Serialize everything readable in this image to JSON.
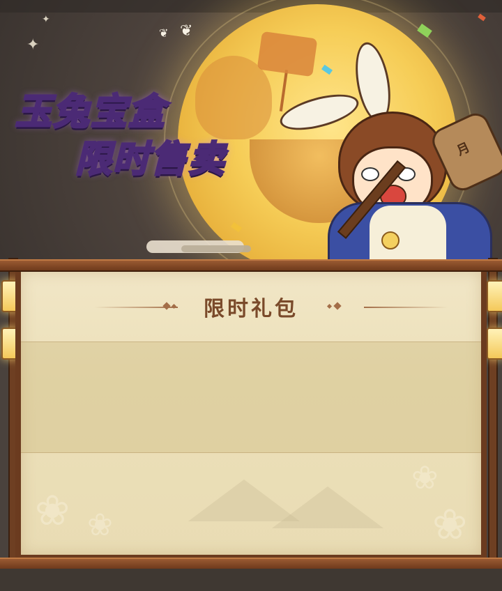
{
  "banner": {
    "title_line1": "玉兔宝盒",
    "title_line2": "限时售卖",
    "hammer_glyph": "月"
  },
  "panel": {
    "section_title": "限时礼包"
  },
  "colors": {
    "title_fill": "#f6e9ff",
    "title_stroke": "#4b2a75",
    "moon": "#f6cd57",
    "panel_text": "#7a4a2a",
    "wood": "#6b3b1f"
  },
  "icons": [
    "sparkle-icon",
    "butterfly-icon",
    "lotus-icon",
    "lantern-icon",
    "hammer-icon",
    "bell-icon"
  ]
}
